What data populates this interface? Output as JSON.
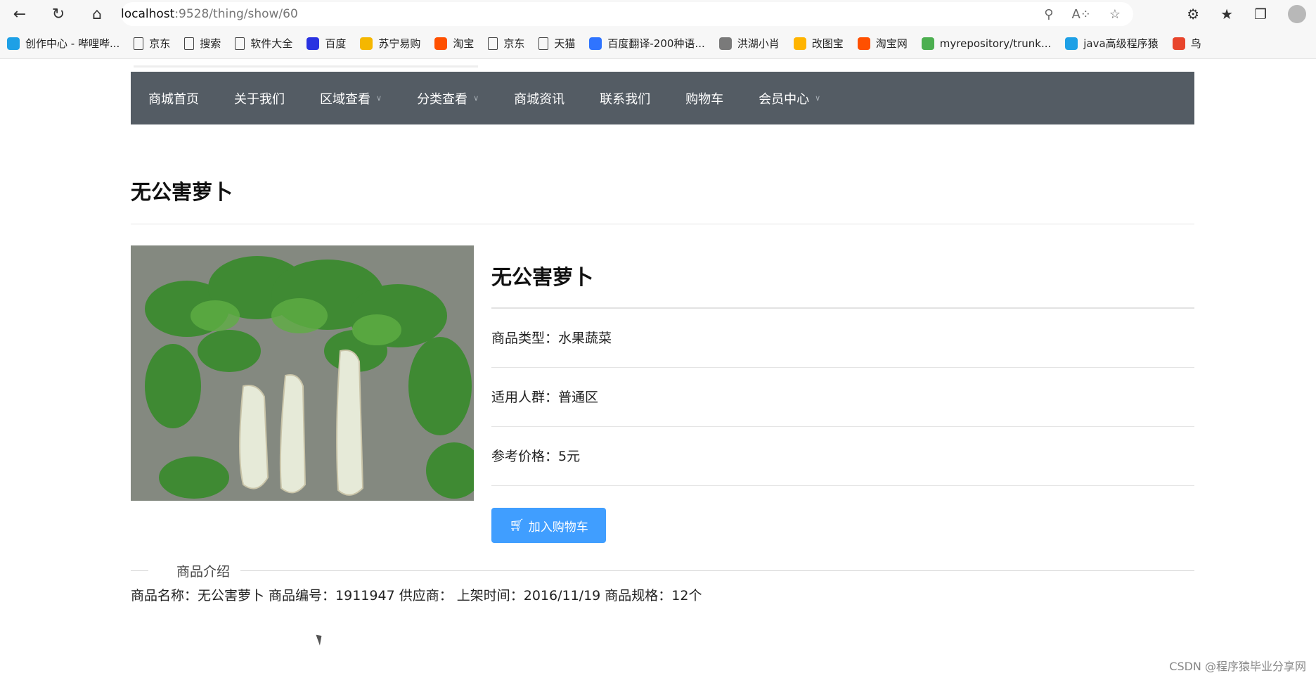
{
  "browser": {
    "url_host": "localhost",
    "url_path": ":9528/thing/show/60",
    "bookmarks": [
      {
        "label": "创作中心 - 哔哩哔...",
        "icon": "bilibili-icon",
        "color": "#1ea0e6"
      },
      {
        "label": "京东",
        "icon": "file-icon"
      },
      {
        "label": "搜索",
        "icon": "file-icon"
      },
      {
        "label": "软件大全",
        "icon": "file-icon"
      },
      {
        "label": "百度",
        "icon": "baidu-paw-icon",
        "color": "#2932e1"
      },
      {
        "label": "苏宁易购",
        "icon": "suning-icon",
        "color": "#f5b700"
      },
      {
        "label": "淘宝",
        "icon": "taobao-icon",
        "color": "#ff5000"
      },
      {
        "label": "京东",
        "icon": "file-icon"
      },
      {
        "label": "天猫",
        "icon": "file-icon"
      },
      {
        "label": "百度翻译-200种语...",
        "icon": "translate-icon",
        "color": "#2f74ff"
      },
      {
        "label": "洪湖小肖",
        "icon": "bird-icon",
        "color": "#7a7a7a"
      },
      {
        "label": "改图宝",
        "icon": "gaitubao-icon",
        "color": "#ffb400"
      },
      {
        "label": "淘宝网",
        "icon": "taobao-icon",
        "color": "#ff5000"
      },
      {
        "label": "myrepository/trunk...",
        "icon": "chrome-icon",
        "color": "#4caf50"
      },
      {
        "label": "java高级程序猿",
        "icon": "bilibili-icon",
        "color": "#1ea0e6"
      },
      {
        "label": "鸟",
        "icon": "bird-red-icon",
        "color": "#e8452c"
      }
    ]
  },
  "nav": {
    "items": [
      {
        "label": "商城首页",
        "dropdown": false
      },
      {
        "label": "关于我们",
        "dropdown": false
      },
      {
        "label": "区域查看",
        "dropdown": true
      },
      {
        "label": "分类查看",
        "dropdown": true
      },
      {
        "label": "商城资讯",
        "dropdown": false
      },
      {
        "label": "联系我们",
        "dropdown": false
      },
      {
        "label": "购物车",
        "dropdown": false
      },
      {
        "label": "会员中心",
        "dropdown": true
      }
    ],
    "bg_color": "#545c64"
  },
  "product": {
    "page_title": "无公害萝卜",
    "name": "无公害萝卜",
    "type_row": "商品类型：水果蔬菜",
    "group_row": "适用人群：普通区",
    "price_row": "参考价格：5元",
    "cart_button": "加入购物车",
    "section_label": "商品介绍",
    "description": "商品名称：无公害萝卜 商品编号：1911947 供应商： 上架时间：2016/11/19 商品规格：12个"
  },
  "watermark": "CSDN @程序猿毕业分享网",
  "accent_color": "#409eff"
}
